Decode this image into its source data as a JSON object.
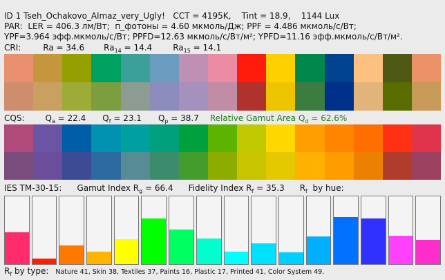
{
  "header": {
    "line1": "ID 1 Tseh_Ochakovo_Almaz_very_Ugly!   CCT = 4195K,    Tint = 18.9,    1144 Lux",
    "line2": "PAR:  LER = 406.3 лм/Вт;  п_фотоны = 4.60 мкмоль/Дж; PPF = 4.486 мкмоль/с/Вт;",
    "line3": "YPF=3.964 эфф.мкмоль/с/Вт; PPFD=12.63 мкмоль/с/Вт/м²; YPFD=11.16 эфф.мкмоль/с/Вт/м²."
  },
  "cri": {
    "label": "CRI:",
    "ra": "Ra = 34.6",
    "r14_pre": "Ra",
    "r14_sub": "14",
    "r14_val": " = 14.4",
    "r15_pre": "Ra",
    "r15_sub": "15",
    "r15_val": " = 14.1",
    "colors_top": [
      "#e89070",
      "#c4963e",
      "#94a000",
      "#00a060",
      "#3ca09a",
      "#6a9cc0",
      "#c090b4",
      "#ec8ca4",
      "#ff1c0c",
      "#ffd000",
      "#00884c",
      "#00428e",
      "#fcc080",
      "#4e5a14",
      "#ec9268"
    ],
    "colors_bottom": [
      "#cc8e6c",
      "#c8a060",
      "#9cac36",
      "#7c9e40",
      "#8c9c90",
      "#8c8cbc",
      "#a690bc",
      "#c08ca6",
      "#b0322c",
      "#ecc400",
      "#3c7c40",
      "#00318a",
      "#e0b47a",
      "#586c00",
      "#c89a5a"
    ]
  },
  "cqs": {
    "label": "CQS:",
    "qa_pre": "Q",
    "qa_sub": "a",
    "qa_val": " = 22.4",
    "qf_pre": "Q",
    "qf_sub": "f",
    "qf_val": " = 23.1",
    "qp_pre": "Q",
    "qp_sub": "p",
    "qp_val": " = 38.7",
    "gamut_pre": "Relative Gamut Area Q",
    "gamut_sub": "d",
    "gamut_val": " = 62.6%",
    "colors_top": [
      "#b04a78",
      "#6a54a4",
      "#005ea6",
      "#0090b0",
      "#00a0a0",
      "#00a07c",
      "#00a03c",
      "#5cb400",
      "#c0c800",
      "#ffd800",
      "#ff9e00",
      "#ff8400",
      "#ff6e00",
      "#ff3014",
      "#e0344c"
    ],
    "colors_bottom": [
      "#7a4c7c",
      "#6a4e9c",
      "#3c4c94",
      "#2c6aa0",
      "#588c94",
      "#3c8c6c",
      "#449c2c",
      "#8cac00",
      "#c8c400",
      "#e4c800",
      "#ffb000",
      "#ff9c00",
      "#ec8000",
      "#b03c2c",
      "#9c4060"
    ]
  },
  "tm30": {
    "label": "IES TM-30-15:",
    "gamut_pre": "Gamut Index R",
    "gamut_sub": "g",
    "gamut_val": " = 66.4",
    "fid_pre": "Fidelity Index R",
    "fid_sub": "f",
    "fid_val": " = 35.3",
    "hue_pre": "R",
    "hue_sub": "f",
    "hue_val": "  by hue:",
    "bars": [
      {
        "level": 0.47,
        "color": "#ff2c6c"
      },
      {
        "level": 0.08,
        "color": "#ff2000"
      },
      {
        "level": 0.28,
        "color": "#ff7800"
      },
      {
        "level": 0.18,
        "color": "#ffb400"
      },
      {
        "level": 0.37,
        "color": "#ffff00"
      },
      {
        "level": 0.67,
        "color": "#00ff00"
      },
      {
        "level": 0.51,
        "color": "#00ff60"
      },
      {
        "level": 0.38,
        "color": "#00ffcc"
      },
      {
        "level": 0.18,
        "color": "#00ffff"
      },
      {
        "level": 0.31,
        "color": "#00e0ff"
      },
      {
        "level": 0.17,
        "color": "#00d0ff"
      },
      {
        "level": 0.41,
        "color": "#00b0ff"
      },
      {
        "level": 0.69,
        "color": "#0070ff"
      },
      {
        "level": 0.67,
        "color": "#3030ff"
      },
      {
        "level": 0.42,
        "color": "#ff40ff"
      },
      {
        "level": 0.36,
        "color": "#ff2ccc"
      }
    ]
  },
  "bytype": {
    "pre": "R",
    "sub": "f",
    "label": "  by type:",
    "values": "Nature 41,  Skin 38,  Textiles 37,  Paints 16,  Plastic 17,  Printed 41,  Color System 49."
  }
}
